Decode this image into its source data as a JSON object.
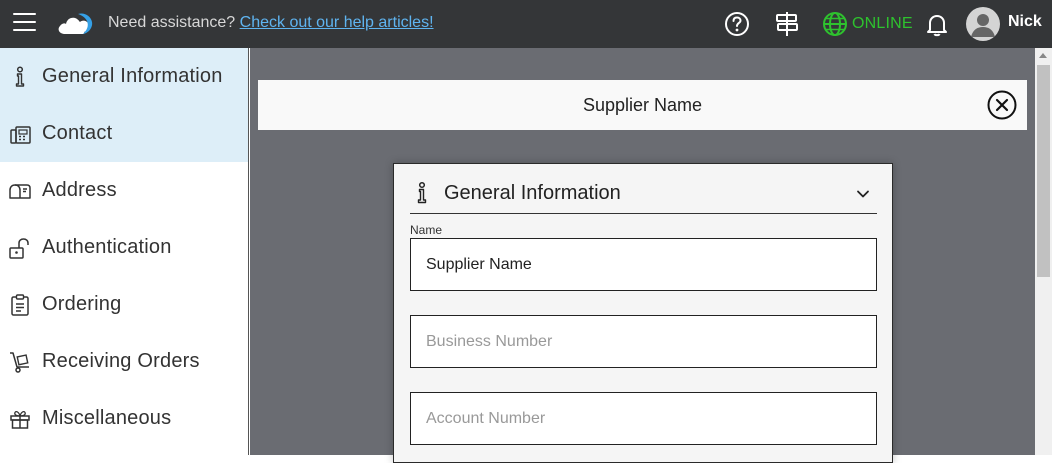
{
  "topbar": {
    "help_prefix": "Need assistance?",
    "help_link": "Check out our help articles!",
    "status": "ONLINE",
    "username": "Nick",
    "icons": [
      "menu-icon",
      "cloud-logo",
      "help-circle-icon",
      "signpost-icon",
      "globe-icon",
      "bell-icon",
      "user-avatar-icon"
    ],
    "colors": {
      "background": "#343638",
      "link": "#5fb4f0",
      "online": "#2ec22e"
    }
  },
  "sidebar": {
    "items": [
      {
        "label": "General Information",
        "icon": "info-icon",
        "active": true
      },
      {
        "label": "Contact",
        "icon": "fax-phone-icon",
        "active": true
      },
      {
        "label": "Address",
        "icon": "mailbox-icon",
        "active": false
      },
      {
        "label": "Authentication",
        "icon": "unlock-icon",
        "active": false
      },
      {
        "label": "Ordering",
        "icon": "clipboard-icon",
        "active": false
      },
      {
        "label": "Receiving Orders",
        "icon": "hand-truck-icon",
        "active": false
      },
      {
        "label": "Miscellaneous",
        "icon": "gift-box-icon",
        "active": false
      }
    ],
    "active_color": "#ddeef8"
  },
  "header": {
    "title": "Supplier Name"
  },
  "card": {
    "title": "General Information",
    "name_label": "Name",
    "name_value": "Supplier Name",
    "business_placeholder": "Business Number",
    "account_placeholder": "Account Number"
  }
}
